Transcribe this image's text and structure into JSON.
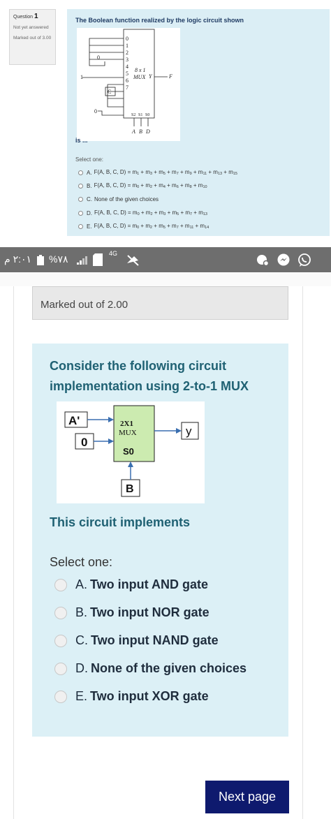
{
  "q1": {
    "info": {
      "question_label": "Question",
      "question_number": "1",
      "status": "Not yet answered",
      "marks": "Marked out of 3.00"
    },
    "title": "The Boolean function realized by the logic circuit shown",
    "circuit": {
      "input_labels": [
        "0",
        "1",
        "C",
        "0"
      ],
      "pin_numbers": [
        "0",
        "1",
        "2",
        "3",
        "4",
        "5",
        "6",
        "7"
      ],
      "mux_label_1": "8 x 1",
      "mux_label_2": "MUX",
      "output_pin": "Y",
      "output_label": "F",
      "select_labels": [
        "S2",
        "S1",
        "S0"
      ],
      "select_inputs": [
        "A",
        "B",
        "D"
      ]
    },
    "is_text": "is ...",
    "select_one": "Select one:",
    "options": [
      {
        "letter": "A.",
        "lhs": "F(A, B, C, D) = ",
        "terms": [
          [
            "m",
            "1"
          ],
          [
            "m",
            "3"
          ],
          [
            "m",
            "5"
          ],
          [
            "m",
            "7"
          ],
          [
            "m",
            "9"
          ],
          [
            "m",
            "11"
          ],
          [
            "m",
            "13"
          ],
          [
            "m",
            "15"
          ]
        ]
      },
      {
        "letter": "B.",
        "lhs": "F(A, B, C, D) = ",
        "terms": [
          [
            "m",
            "0"
          ],
          [
            "m",
            "2"
          ],
          [
            "m",
            "4"
          ],
          [
            "m",
            "6"
          ],
          [
            "m",
            "8"
          ],
          [
            "m",
            "10"
          ]
        ]
      },
      {
        "letter": "C.",
        "text": "None of the given choices"
      },
      {
        "letter": "D.",
        "lhs": "F(A, B, C, D) = ",
        "terms": [
          [
            "m",
            "0"
          ],
          [
            "m",
            "2"
          ],
          [
            "m",
            "3"
          ],
          [
            "m",
            "5"
          ],
          [
            "m",
            "7"
          ],
          [
            "m",
            "13"
          ]
        ]
      },
      {
        "letter": "E.",
        "lhs": "F(A, B, C, D) = ",
        "terms": [
          [
            "m",
            "0"
          ],
          [
            "m",
            "2"
          ],
          [
            "m",
            "5"
          ],
          [
            "m",
            "7"
          ],
          [
            "m",
            "11"
          ],
          [
            "m",
            "14"
          ]
        ]
      }
    ]
  },
  "statusbar": {
    "time": "٢:٠١ م",
    "battery": "%٧٨",
    "network": "4G"
  },
  "q2": {
    "marks": "Marked out of 2.00",
    "title": "Consider the following circuit implementation using 2-to-1 MUX",
    "circuit": {
      "input_top": "A'",
      "input_bottom": "0",
      "mux_line1": "2X1",
      "mux_line2": "MUX",
      "select": "S0",
      "select_input": "B",
      "output": "y"
    },
    "implements": "This circuit implements",
    "select_one": "Select one:",
    "options": [
      {
        "letter": "A.",
        "text": "Two input AND gate"
      },
      {
        "letter": "B.",
        "text": "Two input NOR gate"
      },
      {
        "letter": "C.",
        "text": "Two input NAND gate"
      },
      {
        "letter": "D.",
        "text": "None of the given choices"
      },
      {
        "letter": "E.",
        "text": "Two input XOR gate"
      }
    ]
  },
  "next_button": "Next page"
}
